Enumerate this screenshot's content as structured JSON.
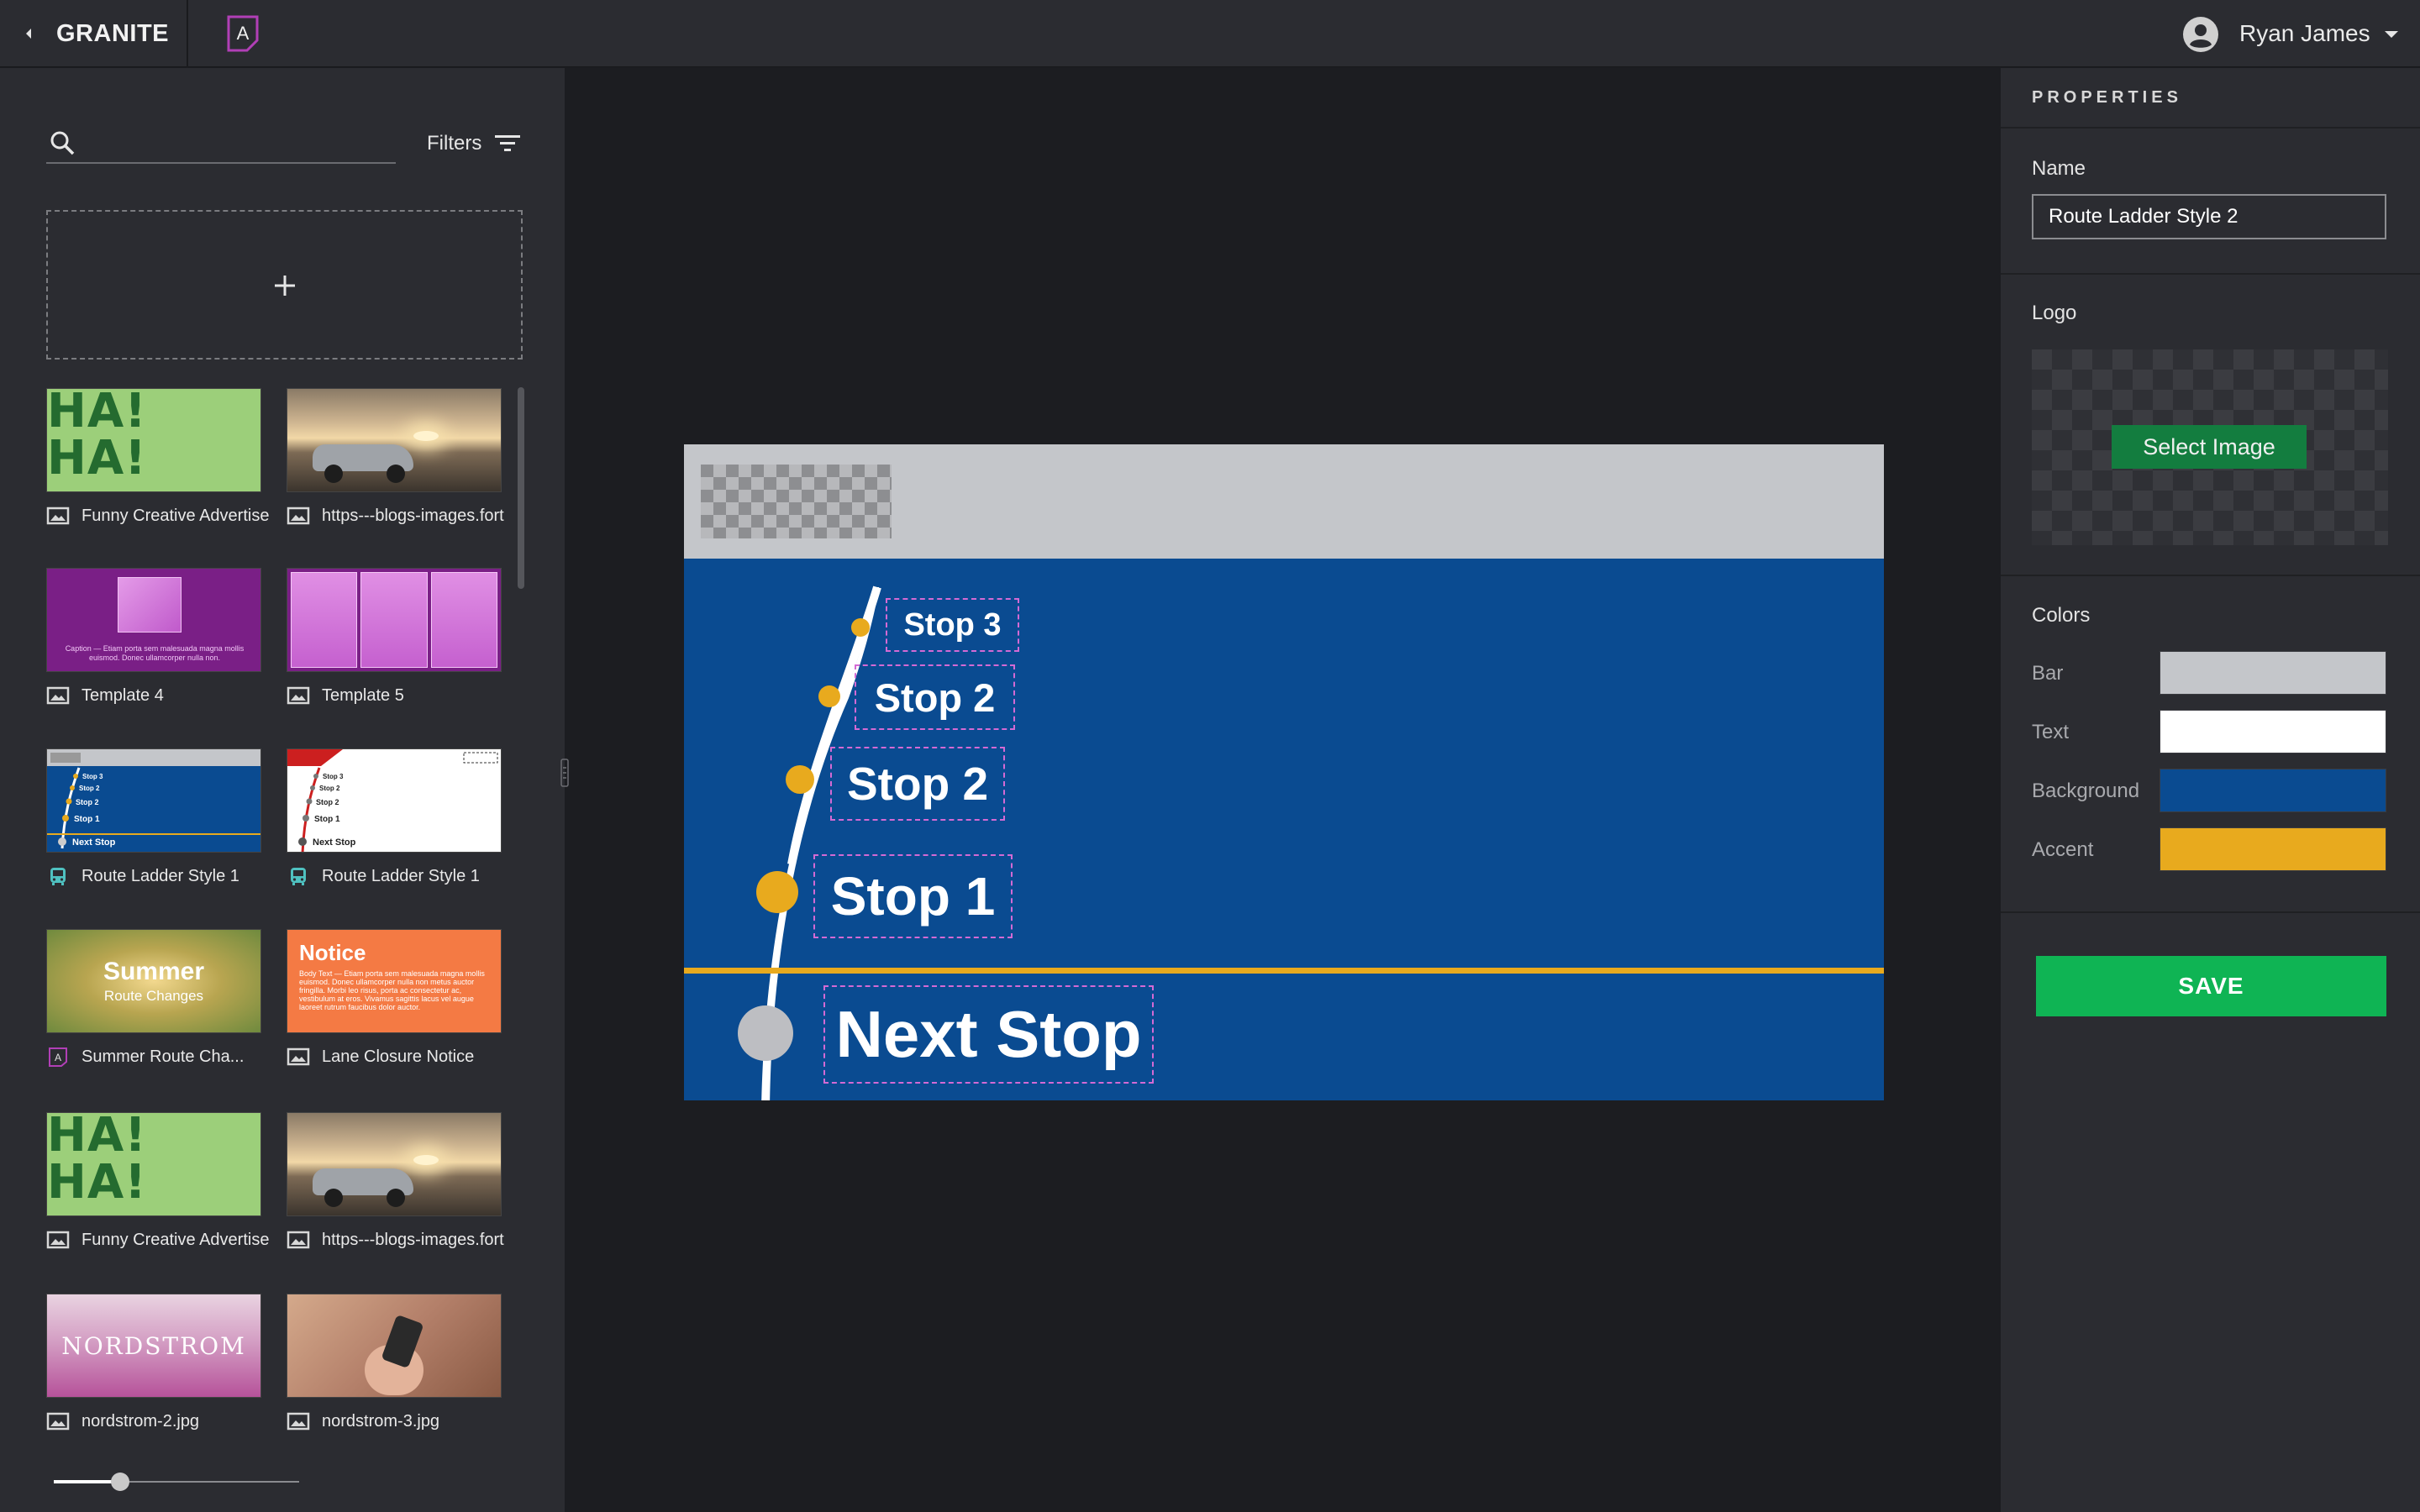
{
  "app": {
    "title": "GRANITE",
    "brand_letter": "A"
  },
  "user": {
    "name": "Ryan James"
  },
  "left_panel": {
    "search": {
      "placeholder": "",
      "value": ""
    },
    "filters_label": "Filters",
    "zoom_level": 0.27,
    "tiles": [
      {
        "label": "Funny Creative Advertise",
        "icon": "image-icon",
        "thumb_text": "HA! HA!"
      },
      {
        "label": "https---blogs-images.fort",
        "icon": "image-icon"
      },
      {
        "label": "Template 4",
        "icon": "image-icon",
        "thumb_text": "Caption — Etiam porta sem malesuada magna mollis euismod. Donec ullamcorper nulla non."
      },
      {
        "label": "Template 5",
        "icon": "image-icon"
      },
      {
        "label": "Route Ladder Style 1",
        "icon": "bus-icon",
        "thumb_stops": [
          "Stop 3",
          "Stop 2",
          "Stop 2",
          "Stop 1",
          "Next Stop"
        ]
      },
      {
        "label": "Route Ladder Style 1",
        "icon": "bus-icon",
        "thumb_stops": [
          "Stop 3",
          "Stop 2",
          "Stop 2",
          "Stop 1",
          "Next Stop"
        ]
      },
      {
        "label": "Summer Route Cha...",
        "icon": "template-a-icon",
        "thumb_title": "Summer",
        "thumb_sub": "Route Changes"
      },
      {
        "label": "Lane Closure Notice",
        "icon": "image-icon",
        "thumb_title": "Notice",
        "thumb_body": "Body Text — Etiam porta sem malesuada magna mollis euismod. Donec ullamcorper nulla non metus auctor fringilla. Morbi leo risus, porta ac consectetur ac, vestibulum at eros. Vivamus sagittis lacus vel augue laoreet rutrum faucibus dolor auctor."
      },
      {
        "label": "Funny Creative Advertise",
        "icon": "image-icon",
        "thumb_text": "HA! HA!"
      },
      {
        "label": "https---blogs-images.fort",
        "icon": "image-icon"
      },
      {
        "label": "nordstrom-2.jpg",
        "icon": "image-icon",
        "thumb_text": "NORDSTROM"
      },
      {
        "label": "nordstrom-3.jpg",
        "icon": "image-icon"
      }
    ]
  },
  "sign": {
    "stops": [
      "Stop 3",
      "Stop 2",
      "Stop 2",
      "Stop 1"
    ],
    "next_stop": "Next Stop"
  },
  "properties": {
    "title": "PROPERTIES",
    "name_label": "Name",
    "name_value": "Route Ladder Style 2",
    "logo_label": "Logo",
    "select_image_label": "Select Image",
    "colors_label": "Colors",
    "colors": [
      {
        "label": "Bar",
        "value": "#c4c6ca"
      },
      {
        "label": "Text",
        "value": "#ffffff"
      },
      {
        "label": "Background",
        "value": "#0a4b91"
      },
      {
        "label": "Accent",
        "value": "#e8aa1e"
      }
    ],
    "save_label": "SAVE"
  }
}
